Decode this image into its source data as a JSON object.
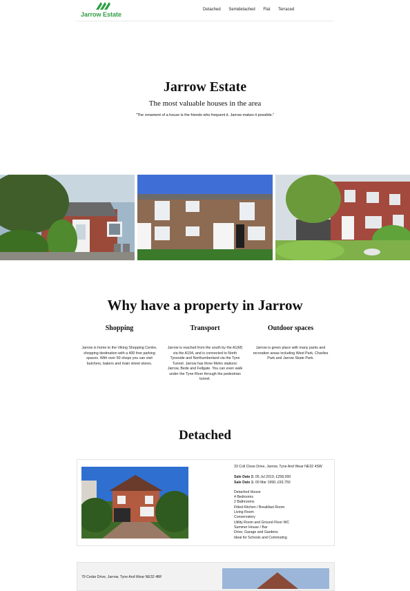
{
  "brand": {
    "name": "Jarrow Estate",
    "color": "#2e9e44"
  },
  "nav": {
    "items": [
      "Detached",
      "Semidetached",
      "Flat",
      "Terraced"
    ]
  },
  "hero": {
    "title": "Jarrow Estate",
    "subtitle": "The most valuable houses in the area",
    "quote": "\"The ornament of a house is the friends who frequent it. Jarrow makes it possible.\""
  },
  "why": {
    "title": "Why have a property in Jarrow",
    "columns": [
      {
        "heading": "Shopping",
        "text": "Jarrow is home to the Viking Shopping Centre, shopping destination with a 400 free parking spaces. With over 50 shops you can visit butchers, bakers and main street stores."
      },
      {
        "heading": "Transport",
        "text": "Jarrow is reached from the south by the A1(M) via the A194, and is connected to North Tyneside and Northumberland via the Tyne Tunnel. Jarrow has three Metro stations: Jarrow, Bede and Fellgate. You can even walk under the Tyne River through the pedestrian tunnel."
      },
      {
        "heading": "Outdoor spaces",
        "text": "Jarrow is green place with many parks and recreation areas including West Park, Charlies Park and Jarrow Skate Park."
      }
    ]
  },
  "detached": {
    "title": "Detached",
    "listing1": {
      "address": "33 Coll Close Drive, Jarrow, Tyne And Wear NE32 4SW",
      "sale1_label": "Sale Date 2:",
      "sale1_value": "05 Jul 2019, £258,000",
      "sale2_label": "Sale Date 1:",
      "sale2_value": "00 Mar 1990, £93,750",
      "features": [
        "Detached House",
        "4 Bedrooms",
        "2 Bathrooms",
        "Fitted Kitchen / Breakfast Room",
        "Living Room",
        "Conservatory",
        "Utility Room and Ground Floor WC",
        "Summer House / Bar",
        "Drive, Garage and Gardens",
        "Ideal for Schools and Commuting"
      ]
    },
    "listing2": {
      "address": "79 Cedar Drive, Jarrow, Tyne And Wear NE32 4BF"
    }
  }
}
